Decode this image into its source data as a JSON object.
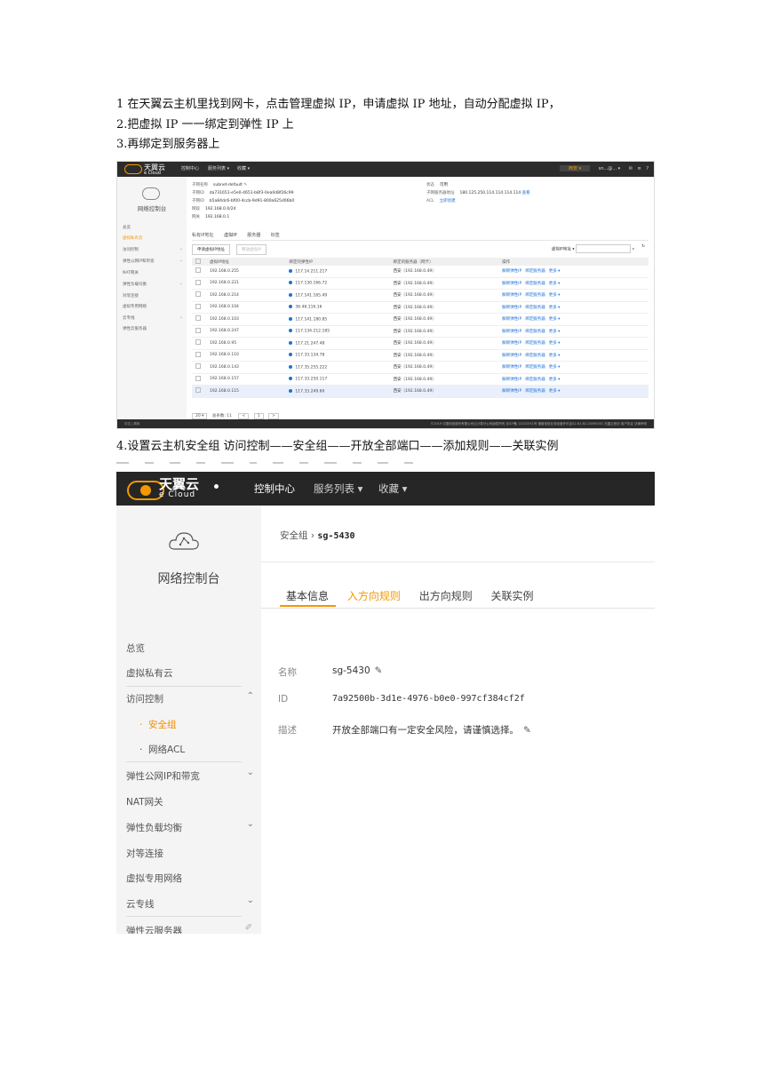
{
  "steps": {
    "s1": "1 在天翼云主机里找到网卡，点击管理虚拟 IP，申请虚拟 IP 地址，自动分配虚拟 IP，",
    "s2": "2.把虚拟 IP 一一绑定到弹性 IP 上",
    "s3": "3.再绑定到服务器上",
    "s4": "4.设置云主机安全组   访问控制——安全组——开放全部端口——添加规则——关联实例"
  },
  "shot1": {
    "brand": "天翼云",
    "brand_sub": "e Cloud",
    "nav": [
      "控制中心",
      "服务列表 ▾",
      "收藏 ▾"
    ],
    "region": "西安 ▾",
    "user": "sn...@... ▾",
    "sidebar_title": "网络控制台",
    "sidebar": [
      "总览",
      "虚拟私有云",
      "访问控制",
      "弹性公网IP和带宽",
      "NAT网关",
      "弹性负载均衡",
      "对等连接",
      "虚拟专用网络",
      "云专线",
      "弹性云服务器"
    ],
    "info": {
      "name_label": "子网名称",
      "name": "subnet-default",
      "id_label": "子网ID",
      "id": "da731651-e5e0-4651-b8f3-0ea0d8f26c99",
      "vpcid_label": "子网ID",
      "vpcid": "b5a84dc6-bf00-4ccb-9d91-800a625d06b0",
      "cidr_label": "网段",
      "cidr": "192.168.0.0/24",
      "gw_label": "网关",
      "gw": "192.168.0.1",
      "status_label": "状态",
      "status": "可用",
      "dns_label": "子网服务器地址",
      "dns": "180.125.250.114.114.114.114",
      "dns_edit": "查看",
      "acl_label": "ACL",
      "acl": "立即创建"
    },
    "tabs": [
      "私有IP地址",
      "虚拟IP",
      "服务器",
      "标签"
    ],
    "btn_apply": "申请虚拟IP地址",
    "btn_release": "释放虚拟IP",
    "filter_label": "虚拟IP地址 ▾",
    "columns": [
      "虚拟IP地址",
      "绑定的弹性IP",
      "绑定的服务器（网卡）",
      "操作"
    ],
    "rows": [
      {
        "vip": "192.168.0.255",
        "eip": "117.14.211.217",
        "srv": "西安（192.168.0.49）"
      },
      {
        "vip": "192.168.0.221",
        "eip": "117.130.166.72",
        "srv": "西安（192.168.0.49）"
      },
      {
        "vip": "192.168.0.214",
        "eip": "117.141.165.49",
        "srv": "西安（192.168.0.49）"
      },
      {
        "vip": "192.168.0.104",
        "eip": "36.46.116.16",
        "srv": "西安（192.168.0.49）"
      },
      {
        "vip": "192.168.0.103",
        "eip": "117.141.180.85",
        "srv": "西安（192.168.0.49）"
      },
      {
        "vip": "192.168.0.247",
        "eip": "117.134.212.185",
        "srv": "西安（192.168.0.49）"
      },
      {
        "vip": "192.168.0.95",
        "eip": "117.21.247.48",
        "srv": "西安（192.168.0.49）"
      },
      {
        "vip": "192.168.0.110",
        "eip": "117.33.134.78",
        "srv": "西安（192.168.0.49）"
      },
      {
        "vip": "192.168.0.143",
        "eip": "117.35.255.222",
        "srv": "西安（192.168.0.49）"
      },
      {
        "vip": "192.168.0.157",
        "eip": "117.33.250.117",
        "srv": "西安（192.168.0.49）"
      },
      {
        "vip": "192.168.0.115",
        "eip": "117.33.249.60",
        "srv": "西安（192.168.0.49）"
      }
    ],
    "op_bind_eip": "解绑弹性IP",
    "op_bind_srv": "绑定服务器",
    "op_more": "更多 ▾",
    "pager": {
      "size": "20 ▾",
      "total": "总条数: 11",
      "prev": "<",
      "page": "1",
      "next": ">"
    },
    "footer_left": "中文 | 简体",
    "footer_right": "©2019 中国电信股份有限公司云计算分公司版权所有  京ICP备 12022551号  增值电信业务经营许可证A2.B1.B2-20090001   天翼云首页   用户协议   法律声明"
  },
  "shot2": {
    "brand": "天翼云",
    "brand_sub": "e Cloud",
    "nav": [
      "控制中心",
      "服务列表 ▾",
      "收藏 ▾"
    ],
    "sidebar_title": "网络控制台",
    "sidebar": {
      "overview": "总览",
      "vpc": "虚拟私有云",
      "access": "访问控制",
      "secgroup": "安全组",
      "acl": "网络ACL",
      "eip": "弹性公网IP和带宽",
      "nat": "NAT网关",
      "elb": "弹性负载均衡",
      "peering": "对等连接",
      "vpn": "虚拟专用网络",
      "dc": "云专线",
      "ecs": "弹性云服务器"
    },
    "breadcrumb_root": "安全组",
    "breadcrumb_sep": "›",
    "breadcrumb_current": "sg-5430",
    "tabs": [
      "基本信息",
      "入方向规则",
      "出方向规则",
      "关联实例"
    ],
    "info": {
      "name_label": "名称",
      "name": "sg-5430",
      "id_label": "ID",
      "id": "7a92500b-3d1e-4976-b0e0-997cf384cf2f",
      "desc_label": "描述",
      "desc": "开放全部端口有一定安全风险，请谨慎选择。"
    },
    "colors": {
      "accent": "#f39800",
      "header": "#262626",
      "sidebar": "#f4f4f4"
    }
  }
}
